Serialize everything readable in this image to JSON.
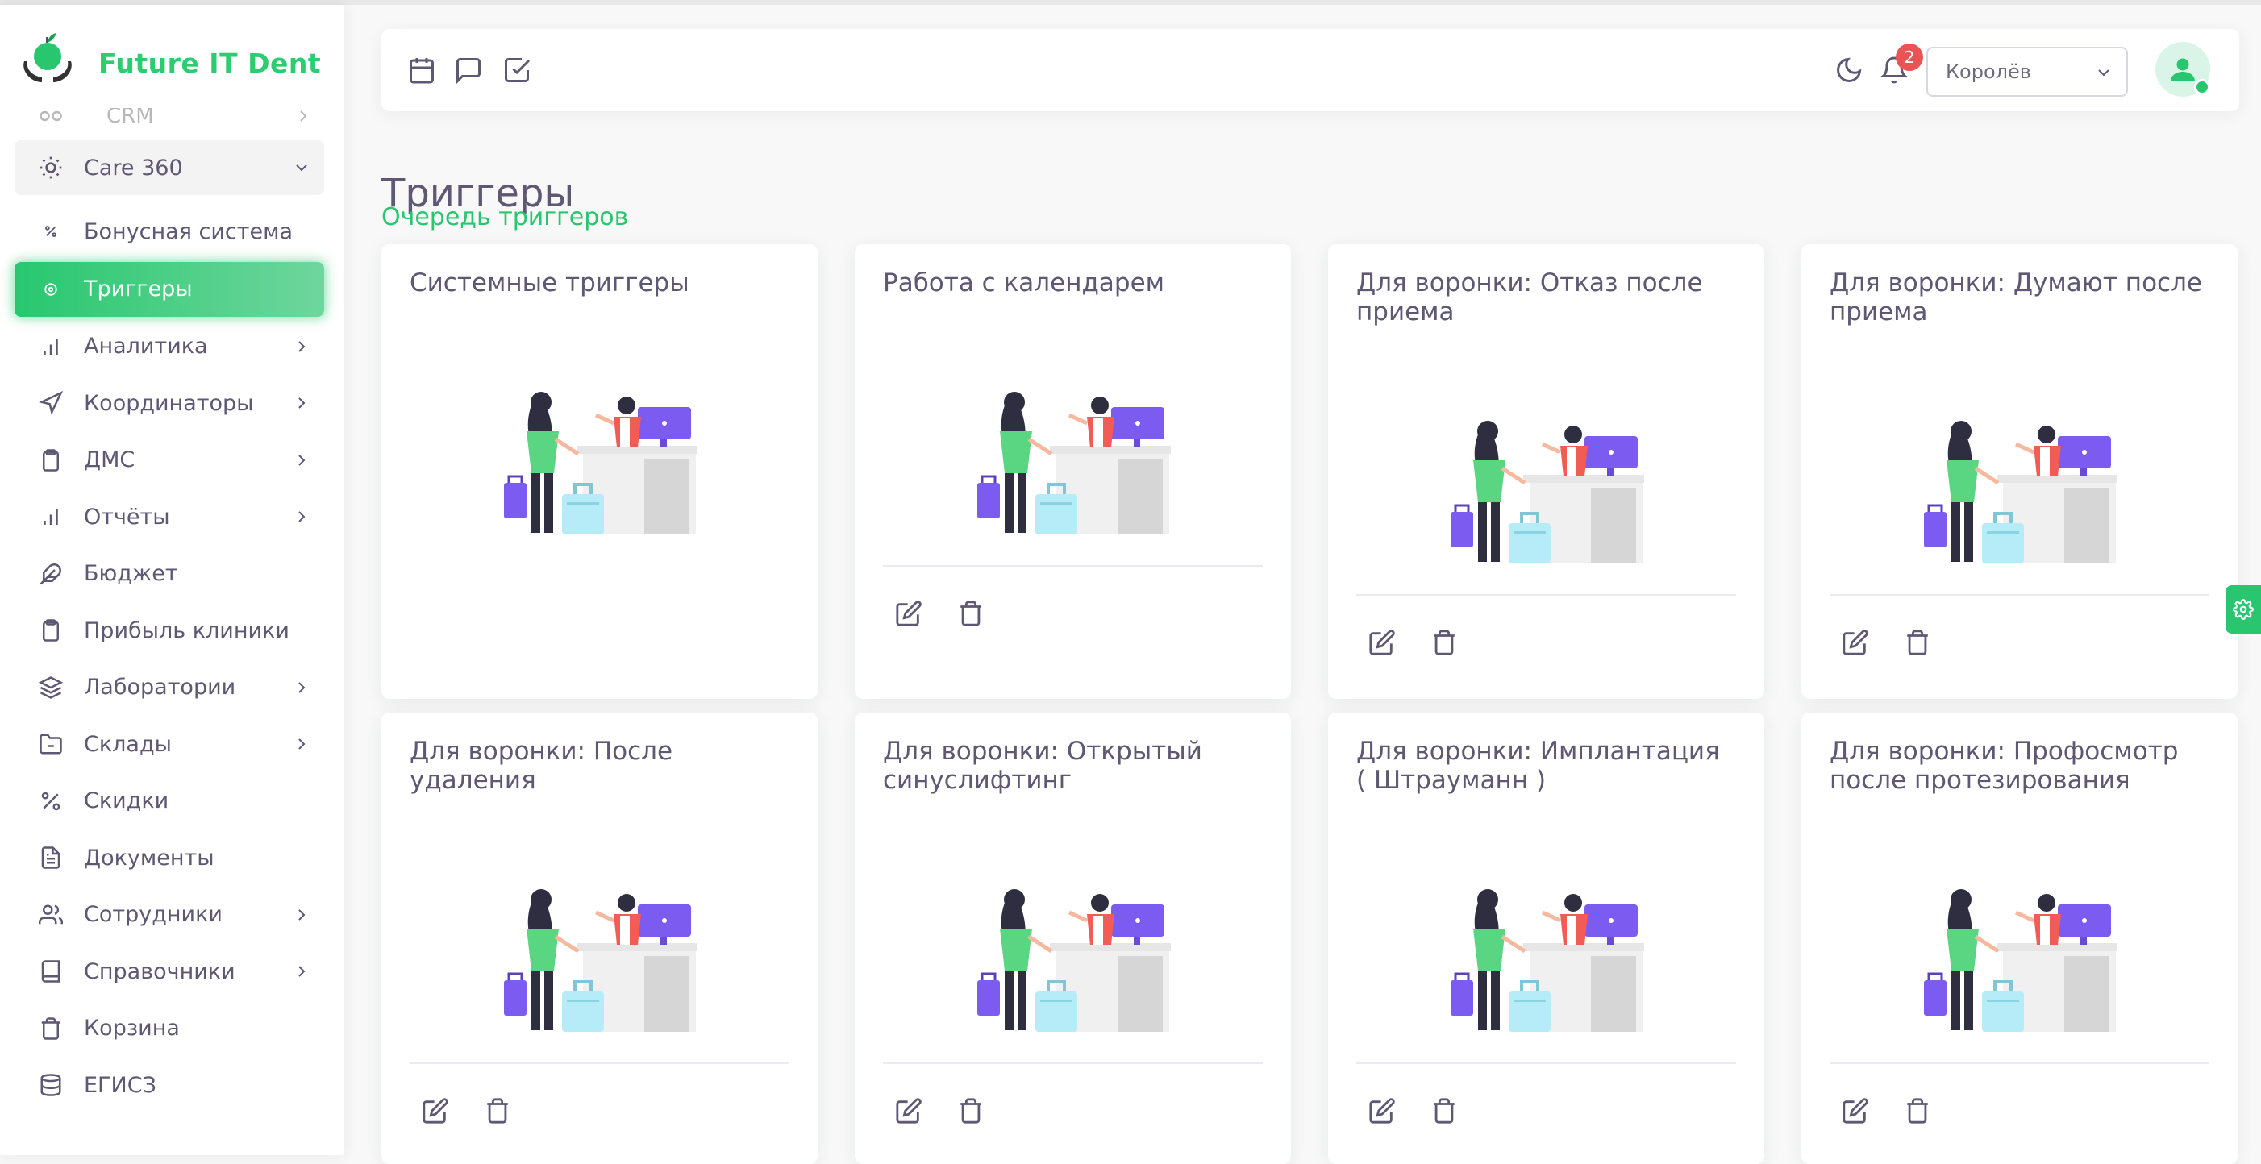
{
  "brand": {
    "name": "Future IT Dent"
  },
  "sidebar": {
    "ghost_item": "CRM",
    "items": [
      {
        "label": "Care 360",
        "icon": "sun-icon",
        "type": "group",
        "chevron": "down"
      },
      {
        "label": "Бонусная система",
        "icon": "percent-small-icon",
        "type": "sub"
      },
      {
        "label": "Триггеры",
        "icon": "circle-target-icon",
        "type": "active"
      },
      {
        "label": "Аналитика",
        "icon": "bar-chart-icon",
        "chevron": "right"
      },
      {
        "label": "Координаторы",
        "icon": "navigation-icon",
        "chevron": "right"
      },
      {
        "label": "ДМС",
        "icon": "clipboard-icon",
        "chevron": "right"
      },
      {
        "label": "Отчёты",
        "icon": "bar-chart-icon",
        "chevron": "right"
      },
      {
        "label": "Бюджет",
        "icon": "feather-icon"
      },
      {
        "label": "Прибыль клиники",
        "icon": "clipboard-icon"
      },
      {
        "label": "Лаборатории",
        "icon": "layers-icon",
        "chevron": "right"
      },
      {
        "label": "Склады",
        "icon": "folder-minus-icon",
        "chevron": "right"
      },
      {
        "label": "Скидки",
        "icon": "percent-icon"
      },
      {
        "label": "Документы",
        "icon": "file-text-icon"
      },
      {
        "label": "Сотрудники",
        "icon": "users-icon",
        "chevron": "right"
      },
      {
        "label": "Справочники",
        "icon": "book-icon",
        "chevron": "right"
      },
      {
        "label": "Корзина",
        "icon": "trash-icon"
      },
      {
        "label": "ЕГИСЗ",
        "icon": "database-icon"
      }
    ]
  },
  "header": {
    "icons": [
      "calendar-icon",
      "message-square-icon",
      "check-square-icon"
    ],
    "notifications_count": "2",
    "branch_select": "Королёв"
  },
  "page": {
    "title": "Триггеры",
    "subtitle": "Очередь триггеров"
  },
  "cards": [
    {
      "title": "Системные триггеры",
      "actions": false
    },
    {
      "title": "Работа с календарем",
      "actions": true
    },
    {
      "title": "Для воронки: Отказ после приема",
      "actions": true
    },
    {
      "title": "Для воронки: Думают после приема",
      "actions": true
    },
    {
      "title": "Для воронки: После удаления",
      "actions": true
    },
    {
      "title": "Для воронки: Открытый синуслифтинг",
      "actions": true
    },
    {
      "title": "Для воронки: Имплантация ( Штрауманн )",
      "actions": true
    },
    {
      "title": "Для воронки: Профосмотр после протезирования",
      "actions": true
    }
  ],
  "colors": {
    "accent": "#28c76f",
    "badge": "#ea5455",
    "text": "#5e5873"
  }
}
